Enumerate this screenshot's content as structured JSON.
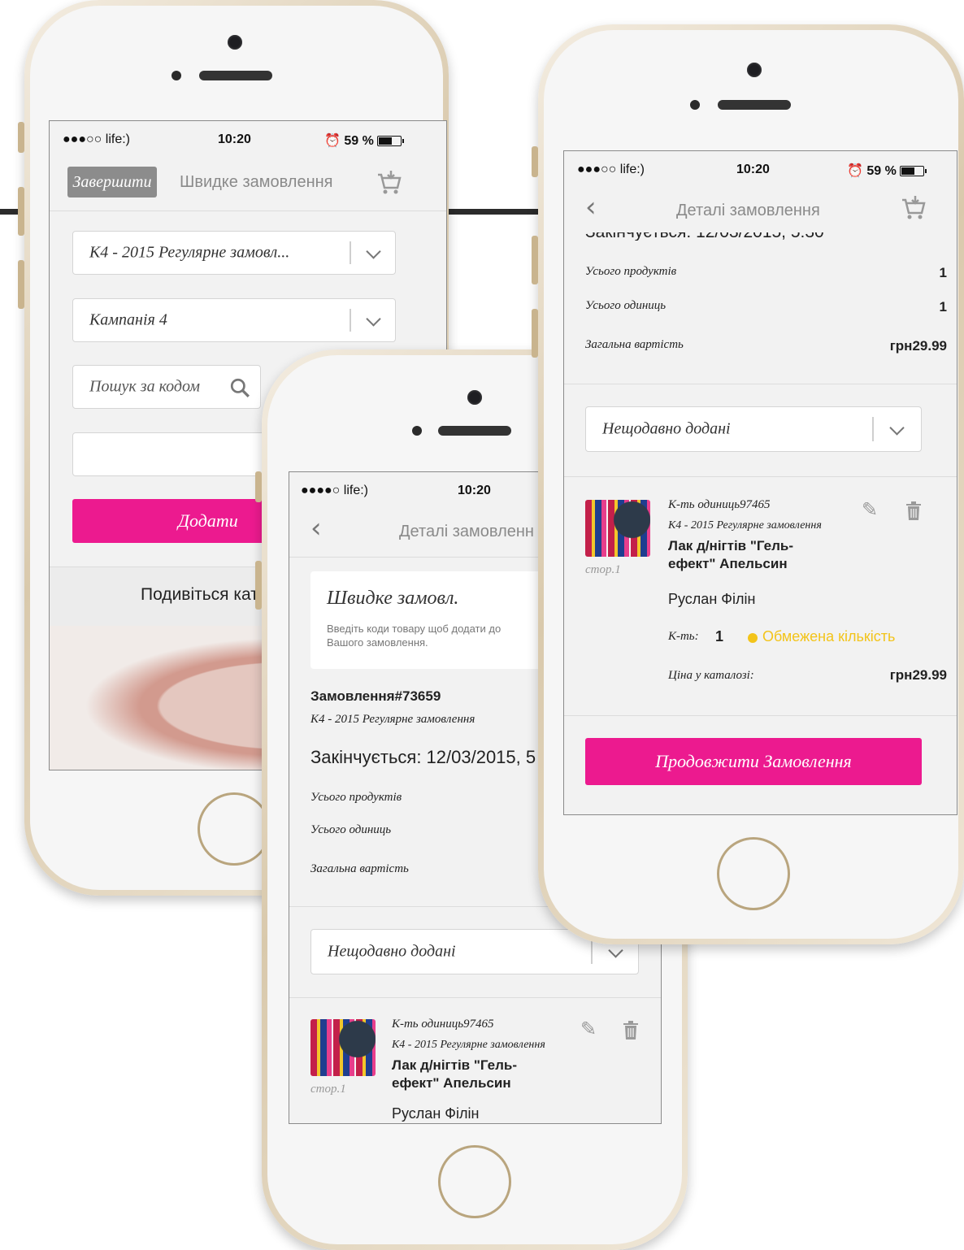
{
  "status": {
    "carrier": "●●●○○ life:)",
    "carrier_front": "●●●●○ life:)",
    "time": "10:20",
    "battery": "59 %"
  },
  "phone_left": {
    "finish_label": "Завершити",
    "title": "Швидке замовлення",
    "order_select": "К4 - 2015 Регулярне замовл...",
    "campaign_select": "Кампанія 4",
    "search_placeholder": "Пошук за кодом",
    "add_button": "Додати",
    "catalog_label": "Подивіться кат"
  },
  "phone_middle": {
    "title": "Деталі замовленн",
    "quick_title": "Швидке замовл.",
    "quick_hint": "Введіть коди товару щоб додати до Вашого замовлення.",
    "order_number": "Замовлення#73659",
    "order_type": "К4 - 2015 Регулярне замовлення",
    "ends": "Закінчується: 12/03/2015, 5",
    "total_products_label": "Усього продуктів",
    "total_units_label": "Усього одиниць",
    "total_cost_label": "Загальна вартість",
    "recent_select": "Нещодавно додані",
    "item": {
      "qty_code": "К-ть одиниць97465",
      "order_type": "К4 - 2015 Регулярне замовлення",
      "name": "Лак д/нігтів \"Гель-ефект\" Апельсин",
      "page": "стор.1",
      "person": "Руслан Філін"
    }
  },
  "phone_right": {
    "title": "Деталі замовлення",
    "ends_partial": "Закінчується: 12/03/2015, 5:30",
    "total_products_label": "Усього продуктів",
    "total_products_value": "1",
    "total_units_label": "Усього одиниць",
    "total_units_value": "1",
    "total_cost_label": "Загальна вартість",
    "total_cost_value": "грн29.99",
    "recent_select": "Нещодавно додані",
    "item": {
      "qty_code": "К-ть одиниць97465",
      "order_type": "К4 - 2015 Регулярне замовлення",
      "name": "Лак д/нігтів \"Гель-ефект\" Апельсин",
      "page": "стор.1",
      "person": "Руслан Філін",
      "qty_label": "К-ть:",
      "qty_value": "1",
      "limited": "Обмежена кількість",
      "price_label": "Ціна у каталозі:",
      "price_value": "грн29.99"
    },
    "continue_button": "Продовжити Замовлення"
  },
  "colors": {
    "accent": "#ec1a8f",
    "warning": "#f3c41a",
    "frame_gold": "#d9c9ac"
  }
}
